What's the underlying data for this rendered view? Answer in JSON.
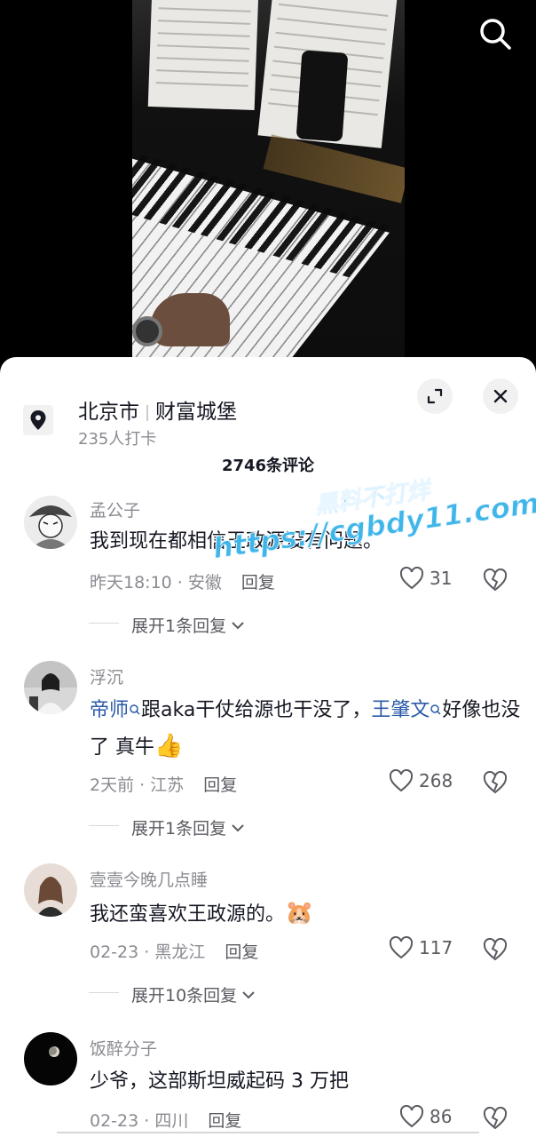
{
  "location": {
    "city": "北京市",
    "place": "财富城堡",
    "checkins": "235人打卡"
  },
  "comment_count": "2746条评论",
  "comments": [
    {
      "user": "孟公子",
      "text": "我到现在都相信王政源没有问题。",
      "time": "昨天18:10 · 安徽",
      "reply": "回复",
      "likes": "31",
      "expand": "展开1条回复"
    },
    {
      "user": "浮沉",
      "mention1": "帝师",
      "text1": "跟aka干仗给源也干没了，",
      "mention2": "王肇文",
      "text2": "好像也没了 真牛",
      "emoji": "👍",
      "time": "2天前 · 江苏",
      "reply": "回复",
      "likes": "268",
      "expand": "展开1条回复"
    },
    {
      "user": "壹壹今晚几点睡",
      "text": "我还蛮喜欢王政源的。",
      "emoji": "🐹",
      "time": "02-23 · 黑龙江",
      "reply": "回复",
      "likes": "117",
      "expand": "展开10条回复"
    },
    {
      "user": "饭醉分子",
      "text": "少爷，这部斯坦威起码 3 万把",
      "time": "02-23 · 四川",
      "reply": "回复",
      "likes": "86"
    }
  ],
  "watermark": {
    "line1": "黑料不打烊",
    "line2": "https://cgbdy11.com"
  },
  "icons": {
    "search": "search-icon",
    "pin": "location-pin-icon",
    "expand": "expand-icon",
    "close": "close-icon",
    "heart": "heart-icon",
    "dislike": "broken-heart-icon"
  }
}
